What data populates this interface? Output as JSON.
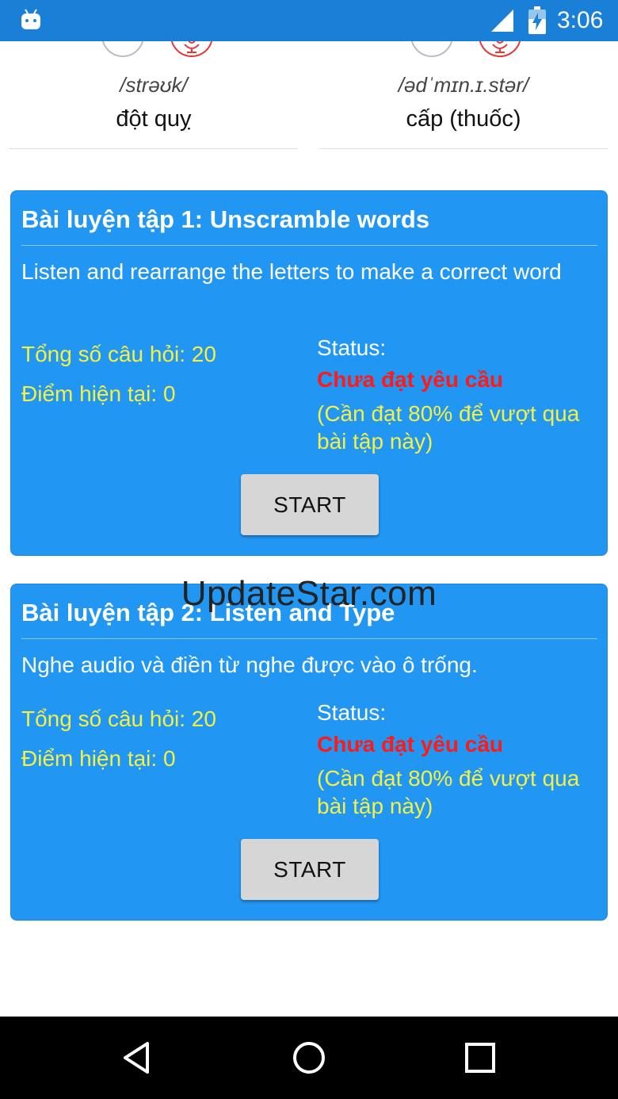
{
  "status_bar": {
    "time": "3:06",
    "icons": [
      "android-icon",
      "signal-icon",
      "battery-charging-icon"
    ],
    "background": "#1a7fd6"
  },
  "vocab": [
    {
      "ipa": "/strəʊk/",
      "meaning": "đột quỵ"
    },
    {
      "ipa": "/ədˈmɪn.ɪ.stər/",
      "meaning": "cấp (thuốc)"
    }
  ],
  "exercises": [
    {
      "title": "Bài luyện tập 1: Unscramble words",
      "description": "Listen and rearrange the letters to make a correct word",
      "total_questions": "Tổng số câu hỏi: 20",
      "current_score": "Điểm hiện tại: 0",
      "status_label": "Status:",
      "status_value": "Chưa đạt yêu cầu",
      "status_note": "(Cần đạt 80% để vượt qua bài tập này)",
      "start_label": "START"
    },
    {
      "title": "Bài luyện tập 2: Listen and Type",
      "description": "Nghe audio và điền từ nghe được vào ô trống.",
      "total_questions": "Tổng số câu hỏi: 20",
      "current_score": "Điểm hiện tại: 0",
      "status_label": "Status:",
      "status_value": "Chưa đạt yêu cầu",
      "status_note": "(Cần đạt 80% để vượt qua bài tập này)",
      "start_label": "START"
    }
  ],
  "watermark": "UpdateStar.com",
  "nav_bar": {
    "buttons": [
      "back-icon",
      "home-icon",
      "recents-icon"
    ]
  },
  "colors": {
    "card_blue": "#2196f3",
    "stat_yellow": "#f4f046",
    "status_red": "#ff1a1a",
    "button_gray": "#d6d6d6"
  }
}
